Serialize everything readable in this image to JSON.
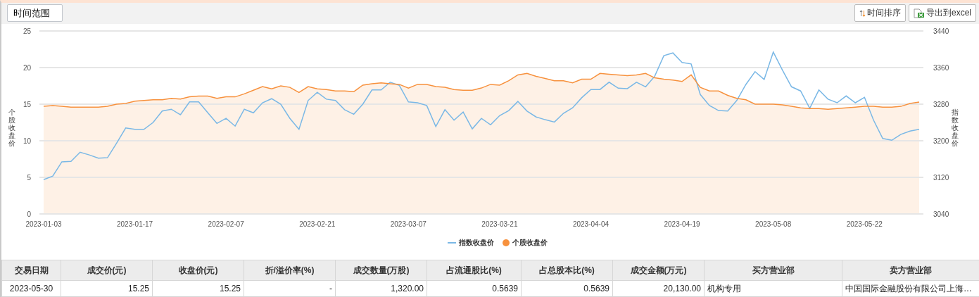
{
  "toolbar": {
    "time_range_button": "时间范围",
    "sort_button": "时间排序",
    "export_button": "导出到excel"
  },
  "chart": {
    "chart_data": {
      "type": "area",
      "grid": true,
      "ylabel": "个股收盘价",
      "y2label": "指数收盘价",
      "ylim": [
        0,
        25
      ],
      "yticks": [
        0,
        5,
        10,
        15,
        20,
        25
      ],
      "y2lim": [
        3040,
        3440
      ],
      "y2ticks": [
        3040,
        3120,
        3200,
        3280,
        3360,
        3440
      ],
      "categories": [
        "2023-01-03",
        null,
        null,
        null,
        null,
        null,
        null,
        null,
        null,
        null,
        "2023-01-17",
        null,
        null,
        null,
        null,
        null,
        null,
        null,
        null,
        null,
        "2023-02-07",
        null,
        null,
        null,
        null,
        null,
        null,
        null,
        null,
        null,
        "2023-02-21",
        null,
        null,
        null,
        null,
        null,
        null,
        null,
        null,
        null,
        "2023-03-07",
        null,
        null,
        null,
        null,
        null,
        null,
        null,
        null,
        null,
        "2023-03-21",
        null,
        null,
        null,
        null,
        null,
        null,
        null,
        null,
        null,
        "2023-04-04",
        null,
        null,
        null,
        null,
        null,
        null,
        null,
        null,
        null,
        "2023-04-19",
        null,
        null,
        null,
        null,
        null,
        null,
        null,
        null,
        null,
        "2023-05-08",
        null,
        null,
        null,
        null,
        null,
        null,
        null,
        null,
        null,
        "2023-05-22",
        null,
        null,
        null,
        null,
        null,
        null
      ],
      "series": [
        {
          "name": "指数收盘价",
          "color": "#7ab8e6",
          "axis": "y2",
          "type": "line",
          "values": [
            3115,
            3123,
            3154,
            3155,
            3175,
            3169,
            3162,
            3163,
            3195,
            3228,
            3225,
            3225,
            3240,
            3265,
            3269,
            3257,
            3285,
            3285,
            3261,
            3238,
            3249,
            3232,
            3269,
            3261,
            3283,
            3292,
            3280,
            3249,
            3225,
            3288,
            3306,
            3291,
            3288,
            3268,
            3258,
            3280,
            3311,
            3311,
            3328,
            3321,
            3285,
            3283,
            3277,
            3231,
            3268,
            3245,
            3263,
            3226,
            3249,
            3235,
            3255,
            3266,
            3286,
            3265,
            3252,
            3246,
            3241,
            3260,
            3272,
            3294,
            3312,
            3312,
            3328,
            3315,
            3314,
            3328,
            3318,
            3341,
            3386,
            3392,
            3371,
            3368,
            3301,
            3277,
            3266,
            3265,
            3288,
            3323,
            3351,
            3334,
            3394,
            3355,
            3318,
            3309,
            3271,
            3311,
            3291,
            3283,
            3298,
            3283,
            3295,
            3245,
            3205,
            3201,
            3214,
            3221,
            3225
          ]
        },
        {
          "name": "个股收盘价",
          "color": "#f7913d",
          "values": [
            14.7,
            14.8,
            14.7,
            14.6,
            14.6,
            14.6,
            14.6,
            14.7,
            15.0,
            15.1,
            15.4,
            15.5,
            15.6,
            15.6,
            15.8,
            15.7,
            16.0,
            16.1,
            16.1,
            15.8,
            16.0,
            16.0,
            16.4,
            16.9,
            17.4,
            17.1,
            17.5,
            17.3,
            16.6,
            17.4,
            17.1,
            17.0,
            16.8,
            16.8,
            16.7,
            17.6,
            17.8,
            17.9,
            17.8,
            17.7,
            17.2,
            17.7,
            17.7,
            17.4,
            17.3,
            17.0,
            16.9,
            16.9,
            17.2,
            17.7,
            17.6,
            18.2,
            19.0,
            19.2,
            18.8,
            18.5,
            18.2,
            18.2,
            17.9,
            18.4,
            18.4,
            19.2,
            19.1,
            19.0,
            18.9,
            19.0,
            19.2,
            18.6,
            18.4,
            18.3,
            18.1,
            19.0,
            17.3,
            16.8,
            16.8,
            16.2,
            15.8,
            15.6,
            15.0,
            15.0,
            15.0,
            14.9,
            14.7,
            14.5,
            14.4,
            14.4,
            14.3,
            14.4,
            14.5,
            14.6,
            14.7,
            14.7,
            14.6,
            14.6,
            14.7,
            15.1,
            15.3
          ]
        }
      ]
    }
  },
  "table": {
    "columns": [
      "交易日期",
      "成交价(元)",
      "收盘价(元)",
      "折/溢价率(%)",
      "成交数量(万股)",
      "占流通股比(%)",
      "占总股本比(%)",
      "成交金额(万元)",
      "买方营业部",
      "卖方营业部"
    ],
    "rows": [
      [
        "2023-05-30",
        "15.25",
        "15.25",
        "-",
        "1,320.00",
        "0.5639",
        "0.5639",
        "20,130.00",
        "机构专用",
        "中国国际金融股份有限公司上海…"
      ]
    ]
  }
}
